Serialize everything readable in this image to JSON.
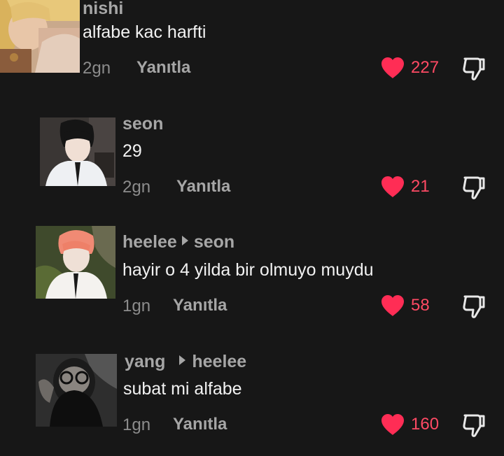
{
  "comments": [
    {
      "username": "nishi",
      "reply_to": "",
      "text": "alfabe kac harfti",
      "time": "2gn",
      "reply_label": "Yanıtla",
      "likes": "227"
    },
    {
      "username": "seon",
      "reply_to": "",
      "text": "29",
      "time": "2gn",
      "reply_label": "Yanıtla",
      "likes": "21"
    },
    {
      "username": "heelee",
      "reply_to": "seon",
      "text": "hayir o 4 yilda bir olmuyo muydu",
      "time": "1gn",
      "reply_label": "Yanıtla",
      "likes": "58"
    },
    {
      "username": "yang",
      "reply_to": "heelee",
      "text": "subat mi alfabe",
      "time": "1gn",
      "reply_label": "Yanıtla",
      "likes": "160"
    }
  ],
  "icons": {
    "like": "heart-icon",
    "dislike": "thumbs-down-icon",
    "reply_marker": "reply-arrow-icon"
  },
  "colors": {
    "background": "#171717",
    "like_active": "#ff4a64",
    "username": "#a6a6a6",
    "text": "#f2f2f2",
    "meta": "#8c8c8c"
  }
}
